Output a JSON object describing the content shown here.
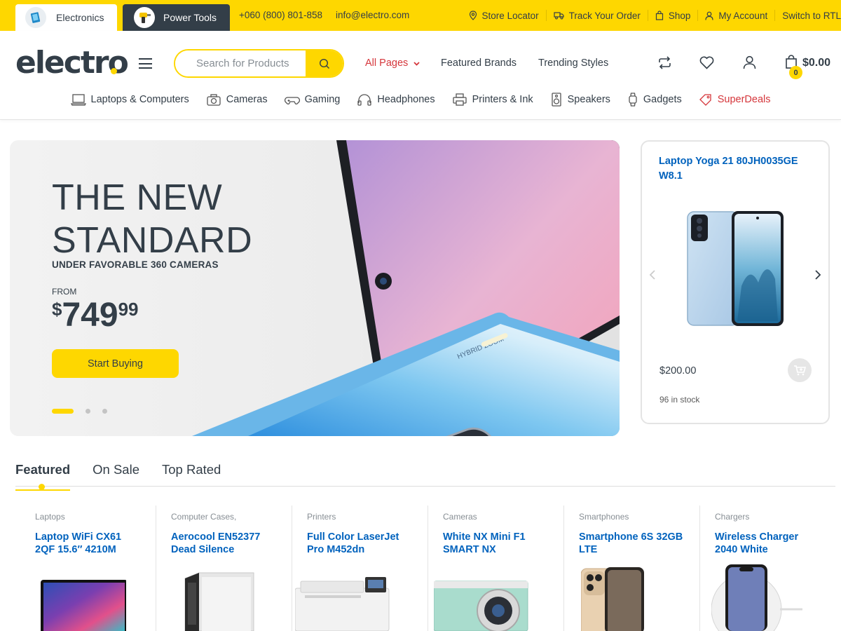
{
  "topbar": {
    "store_tabs": [
      {
        "label": "Electronics"
      },
      {
        "label": "Power Tools"
      }
    ],
    "phone": "+060 (800) 801-858",
    "email": "info@electro.com",
    "links": [
      {
        "label": "Store Locator",
        "icon": "map-pin-icon"
      },
      {
        "label": "Track Your Order",
        "icon": "truck-icon"
      },
      {
        "label": "Shop",
        "icon": "bag-icon"
      },
      {
        "label": "My Account",
        "icon": "user-icon"
      },
      {
        "label": "Switch to RTL",
        "icon": ""
      }
    ]
  },
  "header": {
    "logo": "electro",
    "search_placeholder": "Search for Products",
    "nav": {
      "all_pages": "All Pages",
      "featured_brands": "Featured Brands",
      "trending_styles": "Trending Styles"
    },
    "cart_count": "0",
    "cart_total": "$0.00",
    "categories": [
      {
        "label": "Laptops & Computers",
        "icon": "laptop-icon"
      },
      {
        "label": "Cameras",
        "icon": "camera-icon"
      },
      {
        "label": "Gaming",
        "icon": "gamepad-icon"
      },
      {
        "label": "Headphones",
        "icon": "headphones-icon"
      },
      {
        "label": "Printers & Ink",
        "icon": "printer-icon"
      },
      {
        "label": "Speakers",
        "icon": "speaker-icon"
      },
      {
        "label": "Gadgets",
        "icon": "watch-icon"
      },
      {
        "label": "SuperDeals",
        "icon": "tag-icon"
      }
    ]
  },
  "hero": {
    "title_line1": "THE NEW",
    "title_line2": "STANDARD",
    "subtitle": "UNDER FAVORABLE 360 CAMERAS",
    "from": "FROM",
    "price_currency": "$",
    "price_main": "749",
    "price_cents": "99",
    "button": "Start Buying",
    "phone_text": "HYBRID ZOOM",
    "slide_count": 3,
    "active_slide": 1
  },
  "side_card": {
    "title": "Laptop Yoga 21 80JH0035GE W8.1",
    "price": "$200.00",
    "stock": "96 in stock"
  },
  "tabs": [
    {
      "label": "Featured"
    },
    {
      "label": "On Sale"
    },
    {
      "label": "Top Rated"
    }
  ],
  "products": [
    {
      "category": "Laptops",
      "title": "Laptop WiFi CX61 2QF 15.6″ 4210M"
    },
    {
      "category": "Computer Cases,",
      "title": "Aerocool EN52377 Dead Silence"
    },
    {
      "category": "Printers",
      "title": "Full Color LaserJet Pro M452dn"
    },
    {
      "category": "Cameras",
      "title": "White NX Mini F1 SMART NX"
    },
    {
      "category": "Smartphones",
      "title": "Smartphone 6S 32GB LTE"
    },
    {
      "category": "Chargers",
      "title": "Wireless Charger 2040 White"
    }
  ],
  "colors": {
    "accent": "#fed700",
    "dark": "#333e48",
    "link": "#0062bd",
    "deal": "#d5363b"
  }
}
